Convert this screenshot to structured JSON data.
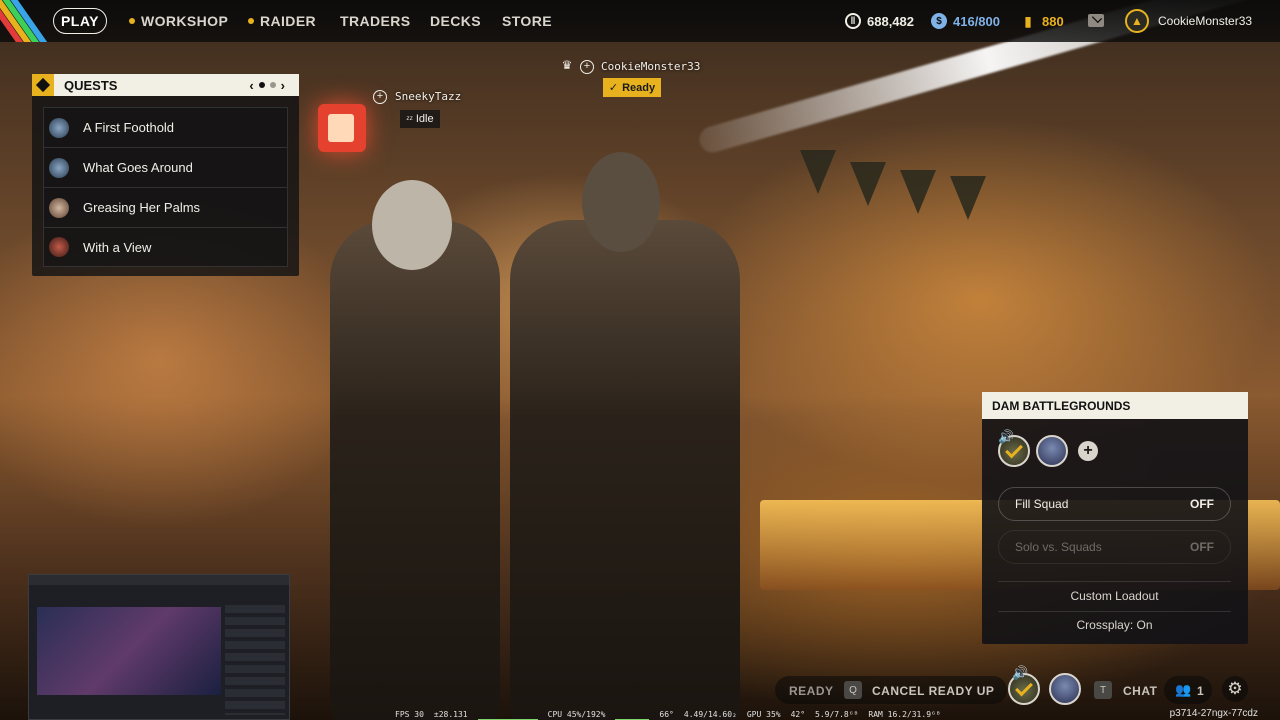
{
  "topbar": {
    "play_label": "PLAY",
    "nav": [
      {
        "label": "WORKSHOP",
        "dot": true
      },
      {
        "label": "RAIDER",
        "dot": true
      },
      {
        "label": "TRADERS",
        "dot": false
      },
      {
        "label": "DECKS",
        "dot": false
      },
      {
        "label": "STORE",
        "dot": false
      }
    ],
    "coins": "688,482",
    "tokens": "416/800",
    "raider_tokens": "880",
    "username": "CookieMonster33"
  },
  "quests": {
    "title": "QUESTS",
    "items": [
      {
        "label": "A First Foothold"
      },
      {
        "label": "What Goes Around"
      },
      {
        "label": "Greasing Her Palms"
      },
      {
        "label": "With a View"
      }
    ]
  },
  "party": {
    "leader": {
      "name": "CookieMonster33",
      "status": "Ready"
    },
    "member": {
      "name": "SneekyTazz",
      "status": "Idle"
    }
  },
  "squad": {
    "title": "DAM BATTLEGROUNDS",
    "fill_squad_label": "Fill Squad",
    "fill_squad_value": "OFF",
    "solo_label": "Solo vs. Squads",
    "solo_value": "OFF",
    "custom_loadout": "Custom Loadout",
    "crossplay": "Crossplay: On"
  },
  "bottombar": {
    "ready": "READY",
    "cancel_key": "Q",
    "cancel_label": "CANCEL READY UP",
    "chat_key": "T",
    "chat_label": "CHAT",
    "friends_count": "1"
  },
  "osd": {
    "fps": "FPS 30",
    "frame": "±28.131",
    "cpu": "CPU 45%/192%",
    "temp_cpu": "66°",
    "clock": "4.49/14.60₂",
    "gpu": "GPU 35%",
    "temp_gpu": "42°",
    "vram": "5.9/7.8ᴳᴮ",
    "ram": "RAM 16.2/31.9ᴳᴮ"
  },
  "build_id": "p3714-27ngx-77cdz",
  "colors": {
    "accent": "#e8b21e",
    "panel_header": "#f2efe4",
    "panel_bg": "#121216"
  }
}
